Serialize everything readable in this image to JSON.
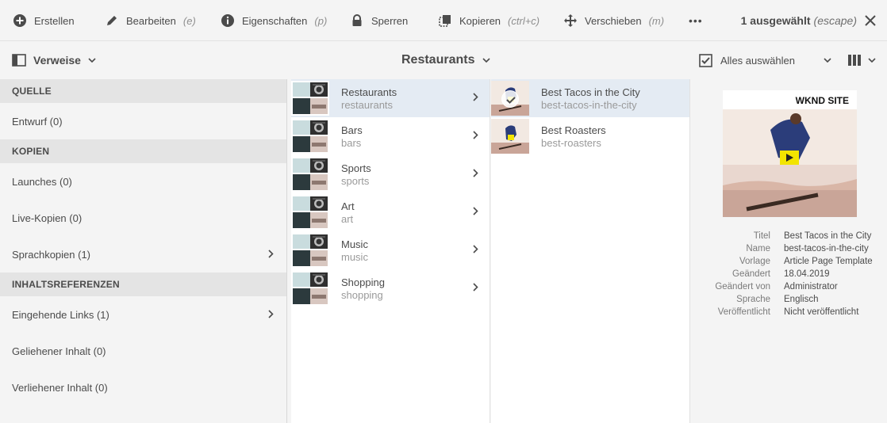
{
  "actionbar": {
    "create": "Erstellen",
    "edit": "Bearbeiten",
    "edit_shortcut": "(e)",
    "properties": "Eigenschaften",
    "properties_shortcut": "(p)",
    "lock": "Sperren",
    "copy": "Kopieren",
    "copy_shortcut": "(ctrl+c)",
    "move": "Verschieben",
    "move_shortcut": "(m)",
    "more": "•••",
    "selected": "1 ausgewählt",
    "selected_shortcut": "(escape)"
  },
  "titlebar": {
    "rail_label": "Verweise",
    "title": "Restaurants",
    "select_all": "Alles auswählen"
  },
  "rail": {
    "sections": [
      {
        "header": "QUELLE",
        "items": [
          {
            "label": "Entwurf (0)"
          }
        ]
      },
      {
        "header": "KOPIEN",
        "items": [
          {
            "label": "Launches (0)"
          },
          {
            "label": "Live-Kopien (0)"
          },
          {
            "label": "Sprachkopien (1)"
          }
        ]
      },
      {
        "header": "INHALTSREFERENZEN",
        "items": [
          {
            "label": "Eingehende Links (1)"
          },
          {
            "label": "Geliehener Inhalt (0)"
          },
          {
            "label": "Verliehener Inhalt (0)"
          }
        ]
      }
    ]
  },
  "column1": [
    {
      "title": "Restaurants",
      "name": "restaurants"
    },
    {
      "title": "Bars",
      "name": "bars"
    },
    {
      "title": "Sports",
      "name": "sports"
    },
    {
      "title": "Art",
      "name": "art"
    },
    {
      "title": "Music",
      "name": "music"
    },
    {
      "title": "Shopping",
      "name": "shopping"
    }
  ],
  "column2": [
    {
      "title": "Best Tacos in the City",
      "name": "best-tacos-in-the-city"
    },
    {
      "title": "Best Roasters",
      "name": "best-roasters"
    }
  ],
  "details": {
    "thumb_title": "WKND SITE",
    "fields": [
      {
        "k": "Titel",
        "v": "Best Tacos in the City"
      },
      {
        "k": "Name",
        "v": "best-tacos-in-the-city"
      },
      {
        "k": "Vorlage",
        "v": "Article Page Template"
      },
      {
        "k": "Geändert",
        "v": "18.04.2019"
      },
      {
        "k": "Geändert von",
        "v": "Administrator"
      },
      {
        "k": "Sprache",
        "v": "Englisch"
      },
      {
        "k": "Veröffentlicht",
        "v": "Nicht veröffentlicht"
      }
    ]
  },
  "colors": {
    "accent": "#2680eb",
    "active_row": "#e4ebf3",
    "text": "#4b4b4b",
    "muted": "#9a9a9a"
  }
}
